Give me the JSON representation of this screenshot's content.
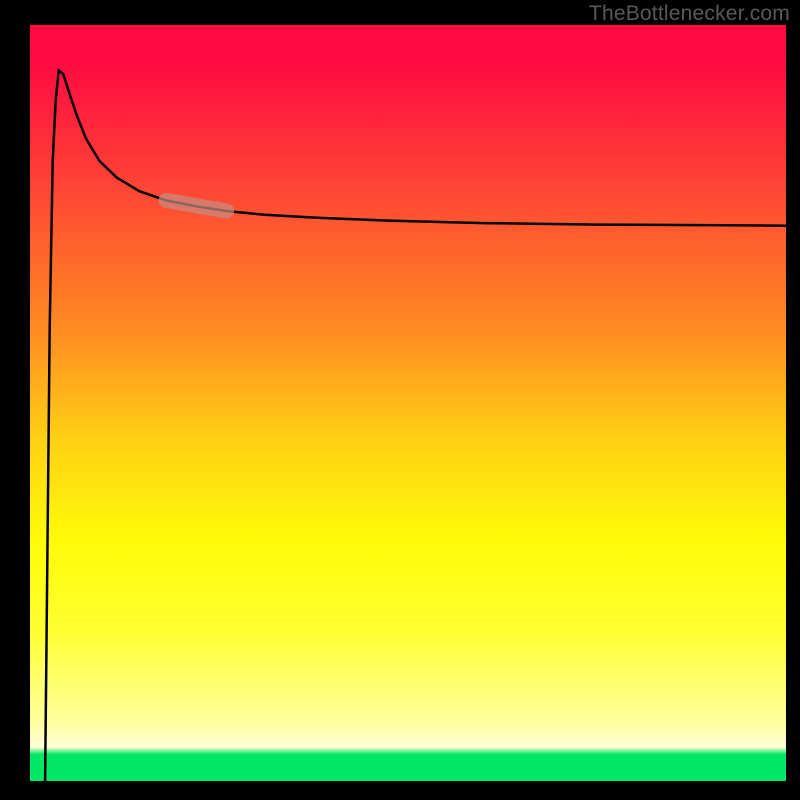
{
  "watermark": "TheBottlenecker.com",
  "chart_data": {
    "type": "line",
    "title": "",
    "xlabel": "",
    "ylabel": "",
    "xlim": [
      0,
      100
    ],
    "ylim": [
      0,
      100
    ],
    "legend": false,
    "grid": false,
    "background": "vertical-gradient-red-to-green",
    "series": [
      {
        "name": "bottleneck-curve",
        "color": "#000000",
        "x_pct": [
          2.0,
          2.6,
          3.0,
          3.4,
          3.8,
          4.4,
          5.2,
          6.2,
          7.4,
          9.2,
          11.5,
          14.5,
          18.0,
          22.0,
          26.0,
          31.0,
          38.0,
          48.0,
          60.0,
          75.0,
          92.0,
          100.0
        ],
        "y_pct": [
          100.0,
          40.0,
          18.0,
          10.0,
          6.0,
          6.5,
          9.0,
          12.0,
          15.0,
          18.0,
          20.2,
          22.0,
          23.2,
          24.0,
          24.6,
          25.1,
          25.5,
          25.9,
          26.2,
          26.4,
          26.5,
          26.55
        ],
        "note": "y_pct is distance from top of plot in percent (higher =  lower on image). Curve drops to near-bottom at ~x=3 then rises asymptotically toward y≈26 from top."
      },
      {
        "name": "highlight-segment",
        "color": "#c88a80",
        "opacity": 0.72,
        "thickness_px": 15,
        "x_pct": [
          18.0,
          26.0
        ],
        "y_pct": [
          23.2,
          24.6
        ],
        "note": "short rounded overlay stroke on the curve"
      }
    ]
  }
}
